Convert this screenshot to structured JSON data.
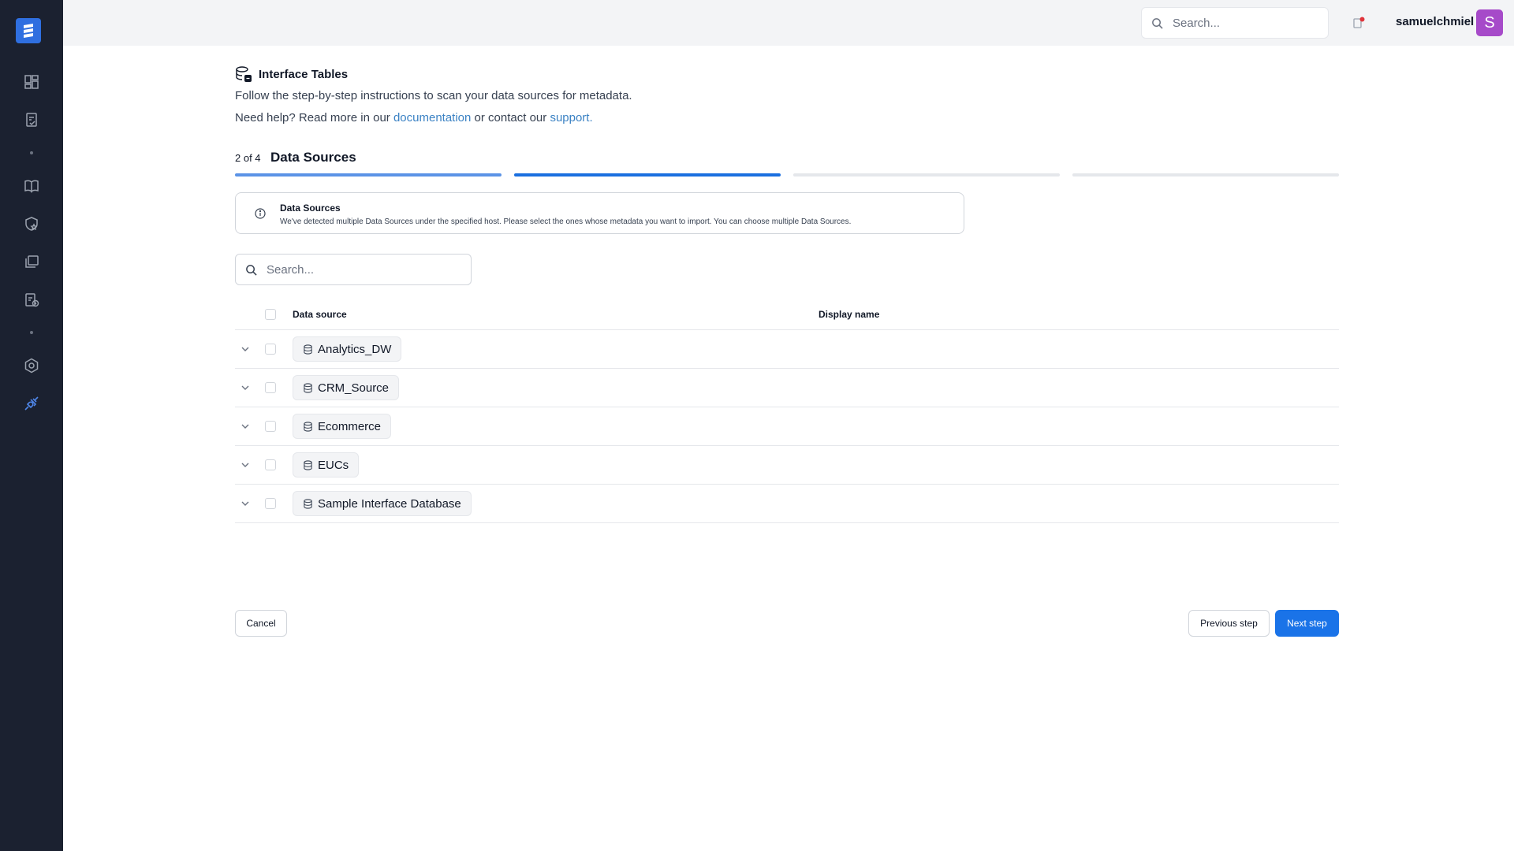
{
  "app": {
    "logo_icon": "app-logo-icon"
  },
  "sidebar": {
    "items": [
      {
        "icon": "dashboard-icon"
      },
      {
        "icon": "clipboard-check-icon"
      },
      {
        "icon": "book-icon"
      },
      {
        "icon": "shield-star-icon"
      },
      {
        "icon": "folders-icon"
      },
      {
        "icon": "clipboard-clock-icon"
      },
      {
        "icon": "settings-hex-icon"
      },
      {
        "icon": "plug-icon",
        "active": true
      }
    ]
  },
  "topbar": {
    "search_placeholder": "Search...",
    "username": "samuelchmiel",
    "avatar_letter": "S",
    "avatar_color": "#a64ac9"
  },
  "header": {
    "title": "Interface Tables",
    "intro": "Follow the step-by-step instructions to scan your data sources for metadata.",
    "help_prefix": "Need help? Read more in our ",
    "help_link_docs": "documentation",
    "help_middle": " or contact our ",
    "help_link_support": "support."
  },
  "stepper": {
    "step_count": "2 of 4",
    "step_title": "Data Sources",
    "current_step": 2,
    "total_steps": 4,
    "colors": {
      "done": "#5b93e6",
      "active": "#1a6fe0",
      "todo": "#e5e7eb"
    }
  },
  "info": {
    "title": "Data Sources",
    "description": "We've detected multiple Data Sources under the specified host. Please select the ones whose metadata you want to import. You can choose multiple Data Sources."
  },
  "table": {
    "search_placeholder": "Search...",
    "columns": {
      "data_source": "Data source",
      "display_name": "Display name"
    },
    "rows": [
      {
        "name": "Analytics_DW",
        "display_name": ""
      },
      {
        "name": "CRM_Source",
        "display_name": ""
      },
      {
        "name": "Ecommerce",
        "display_name": ""
      },
      {
        "name": "EUCs",
        "display_name": ""
      },
      {
        "name": "Sample Interface Database",
        "display_name": ""
      }
    ]
  },
  "footer": {
    "cancel_label": "Cancel",
    "previous_label": "Previous step",
    "next_label": "Next step",
    "accent_color": "#1a73e8"
  }
}
